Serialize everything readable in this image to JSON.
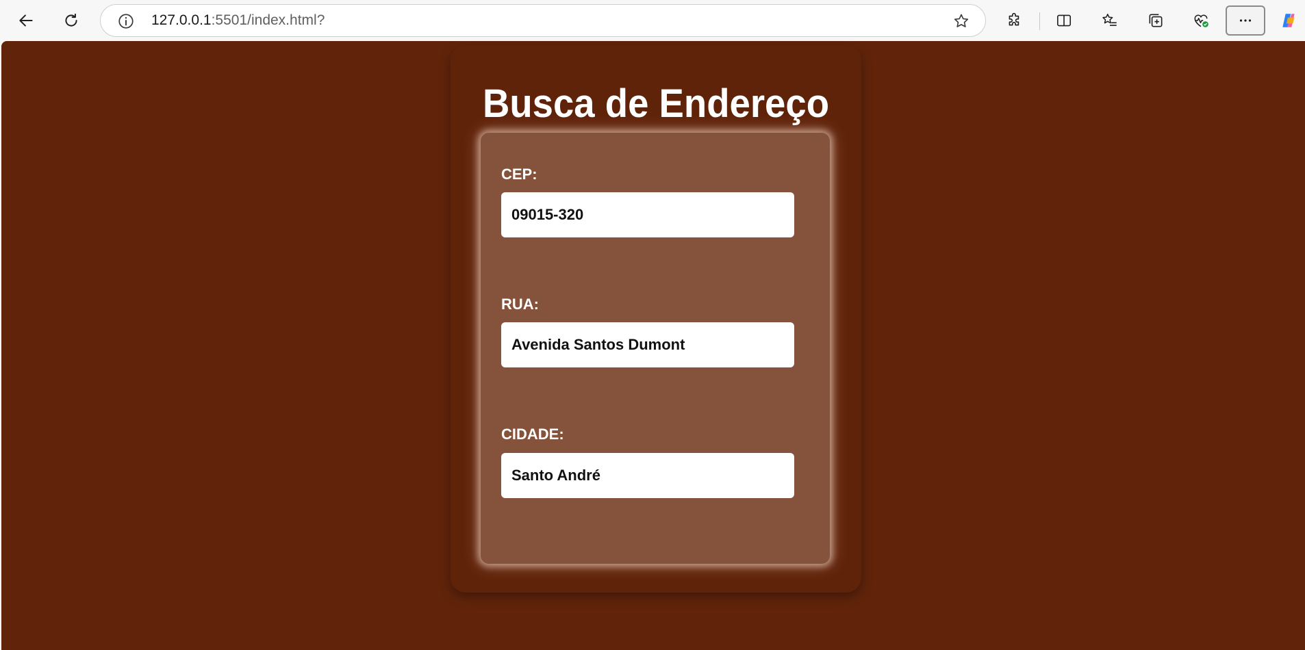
{
  "browser": {
    "url_host": "127.0.0.1",
    "url_rest": ":5501/index.html?",
    "icons": {
      "back": "back-arrow-icon",
      "reload": "reload-icon",
      "info": "info-icon",
      "favorite": "star-icon",
      "extensions": "puzzle-icon",
      "split": "split-screen-icon",
      "favorites": "favorites-list-icon",
      "collections": "collections-icon",
      "health": "browser-essentials-icon",
      "more": "more-icon",
      "copilot": "copilot-icon"
    }
  },
  "page": {
    "background_color": "#61240b",
    "title": "Busca de Endereço",
    "fields": [
      {
        "label": "CEP:",
        "value": "09015-320"
      },
      {
        "label": "RUA:",
        "value": "Avenida Santos Dumont"
      },
      {
        "label": "CIDADE:",
        "value": "Santo André"
      }
    ]
  }
}
